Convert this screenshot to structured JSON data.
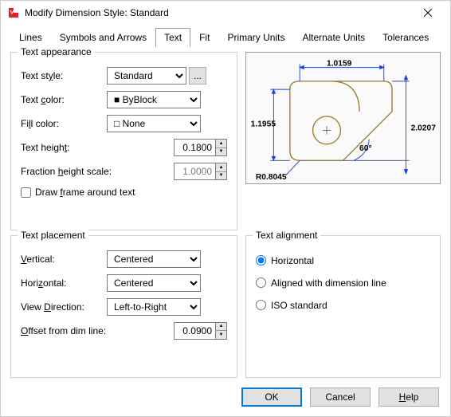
{
  "window": {
    "title": "Modify Dimension Style: Standard"
  },
  "tabs": {
    "lines": "Lines",
    "symbols": "Symbols and Arrows",
    "text": "Text",
    "fit": "Fit",
    "primary": "Primary Units",
    "alternate": "Alternate Units",
    "tolerances": "Tolerances"
  },
  "appearance": {
    "legend": "Text appearance",
    "style_label": "Text style:",
    "style_value": "Standard",
    "more_btn": "...",
    "color_label": "Text color:",
    "color_value": "ByBlock",
    "fill_label": "Fill color:",
    "fill_value": "None",
    "height_label": "Text height:",
    "height_value": "0.1800",
    "fraction_label": "Fraction height scale:",
    "fraction_value": "1.0000",
    "frame_label": "Draw frame around text"
  },
  "placement": {
    "legend": "Text placement",
    "vertical_label": "Vertical:",
    "vertical_value": "Centered",
    "horizontal_label": "Horizontal:",
    "horizontal_value": "Centered",
    "viewdir_label": "View Direction:",
    "viewdir_value": "Left-to-Right",
    "offset_label": "Offset from dim line:",
    "offset_value": "0.0900"
  },
  "alignment": {
    "legend": "Text alignment",
    "horizontal": "Horizontal",
    "aligned": "Aligned with dimension line",
    "iso": "ISO standard"
  },
  "preview": {
    "dim1": "1.0159",
    "dim2": "1.1955",
    "dim3": "2.0207",
    "angle": "60°",
    "radius": "R0.8045"
  },
  "footer": {
    "ok": "OK",
    "cancel": "Cancel",
    "help": "Help"
  }
}
